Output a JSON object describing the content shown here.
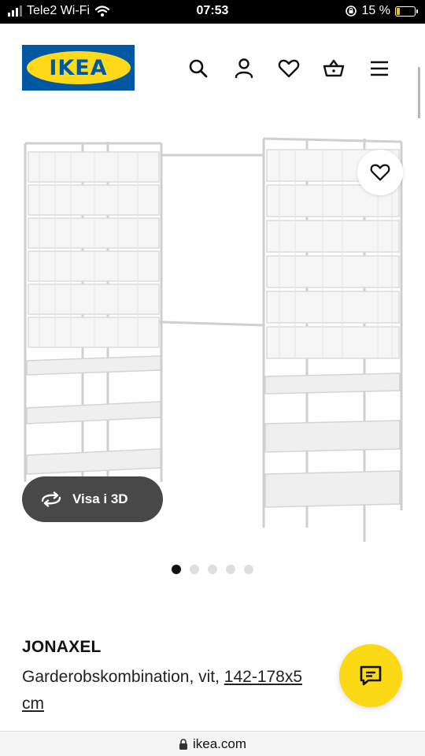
{
  "status_bar": {
    "carrier": "Tele2 Wi-Fi",
    "time": "07:53",
    "battery": "15 %"
  },
  "header": {
    "logo_text": "IKEA",
    "icons": [
      "search-icon",
      "user-icon",
      "heart-icon",
      "basket-icon",
      "menu-icon"
    ]
  },
  "gallery": {
    "view_3d_label": "Visa i 3D",
    "dots_total": 5,
    "active_index": 0
  },
  "product": {
    "name": "JONAXEL",
    "description": "Garderobskombination, vit, ",
    "size": "142-178x5",
    "size_cont": "cm"
  },
  "browser": {
    "url": "ikea.com"
  },
  "colors": {
    "ikea_blue": "#0058a3",
    "ikea_yellow": "#ffda1a",
    "chat_yellow": "#fbd914",
    "pill_dark": "#484848"
  }
}
